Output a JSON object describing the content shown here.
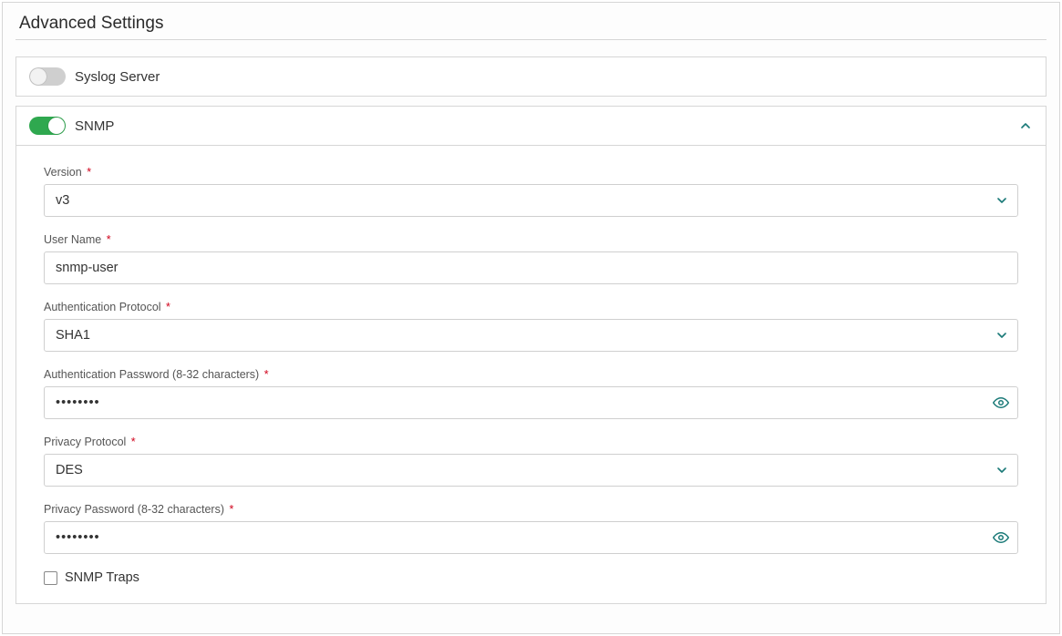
{
  "section_title": "Advanced Settings",
  "panels": {
    "syslog": {
      "title": "Syslog Server",
      "enabled": false
    },
    "snmp": {
      "title": "SNMP",
      "enabled": true,
      "expanded": true
    }
  },
  "snmp_form": {
    "version": {
      "label": "Version",
      "value": "v3"
    },
    "user_name": {
      "label": "User Name",
      "value": "snmp-user"
    },
    "auth_protocol": {
      "label": "Authentication Protocol",
      "value": "SHA1"
    },
    "auth_password": {
      "label": "Authentication Password (8-32 characters)",
      "value": "••••••••"
    },
    "privacy_protocol": {
      "label": "Privacy Protocol",
      "value": "DES"
    },
    "privacy_password": {
      "label": "Privacy Password (8-32 characters)",
      "value": "••••••••"
    },
    "snmp_traps": {
      "label": "SNMP Traps",
      "checked": false
    }
  },
  "required_marker": "*"
}
